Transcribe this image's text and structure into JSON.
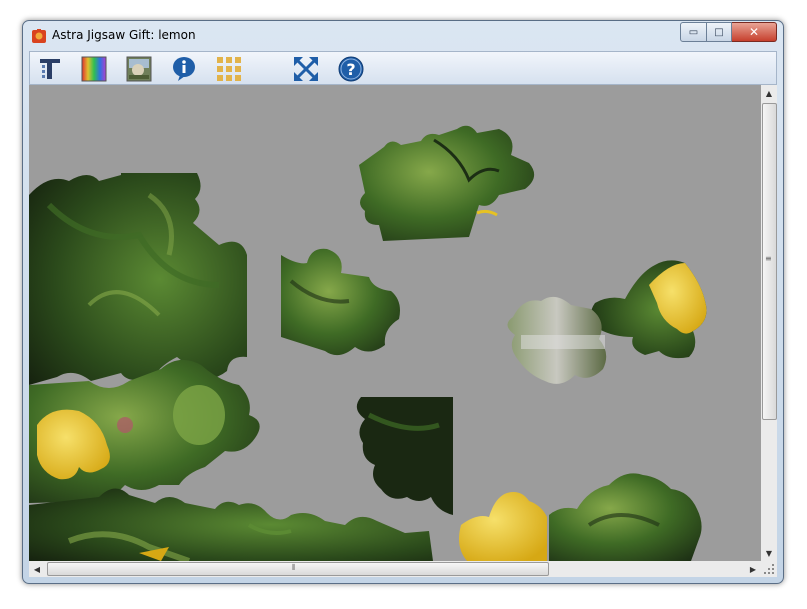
{
  "window": {
    "title": "Astra Jigsaw Gift: lemon",
    "controls": {
      "minimize": "▭",
      "maximize": "□",
      "close": "✕"
    }
  },
  "toolbar": {
    "buttons": [
      {
        "id": "new-puzzle",
        "icon": "cut-pattern-icon"
      },
      {
        "id": "background",
        "icon": "color-palette-icon"
      },
      {
        "id": "preview",
        "icon": "picture-preview-icon"
      },
      {
        "id": "info",
        "icon": "info-icon"
      },
      {
        "id": "arrange",
        "icon": "grid-arrange-icon"
      },
      {
        "id": "fullscreen",
        "icon": "fullscreen-icon"
      },
      {
        "id": "help",
        "icon": "help-icon"
      }
    ]
  },
  "puzzle": {
    "image": "lemon",
    "background_color": "#9c9c9c"
  },
  "colors": {
    "leaf_dark": "#1c2e14",
    "leaf_mid": "#3f6b25",
    "leaf_light": "#86a84a",
    "lemon": "#e6c223"
  }
}
